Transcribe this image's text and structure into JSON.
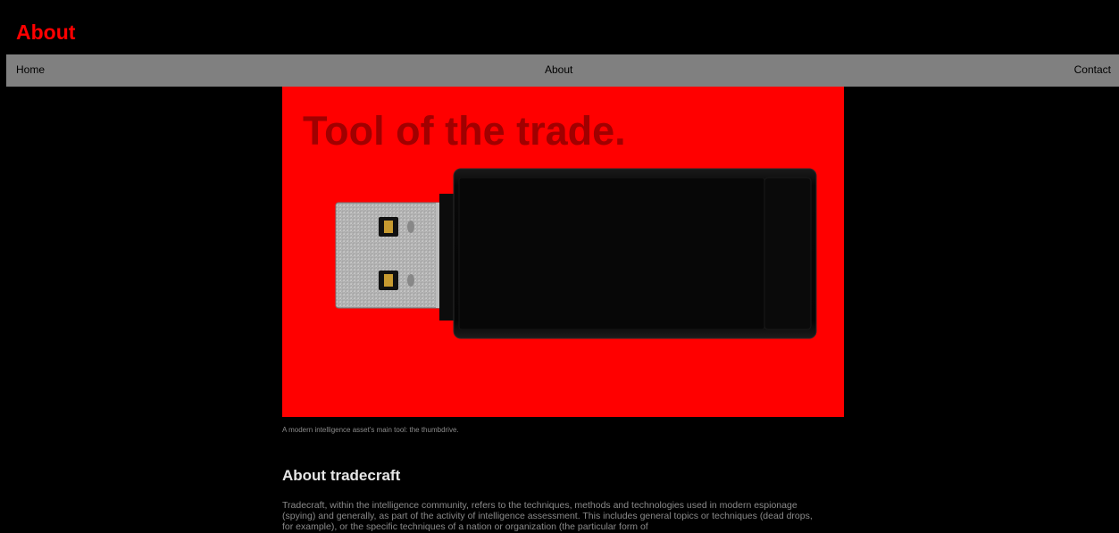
{
  "header": {
    "title": "About"
  },
  "nav": {
    "home": "Home",
    "about": "About",
    "contact": "Contact"
  },
  "hero": {
    "heading": "Tool of the trade.",
    "caption": "A modern intelligence asset's main tool: the thumbdrive."
  },
  "section": {
    "heading": "About tradecraft",
    "body": "Tradecraft, within the intelligence community, refers to the techniques, methods and technologies used in modern espionage (spying) and generally, as part of the activity of intelligence assessment. This includes general topics or techniques (dead drops, for example), or the specific techniques of a nation or organization (the particular form of"
  },
  "colors": {
    "background": "#000000",
    "title_red": "#ff0000",
    "hero_red": "#ff0000",
    "hero_heading": "#a00000",
    "nav_gray": "#808080",
    "muted_text": "#8a8a8a"
  },
  "icons": {
    "hero_image": "usb-thumbdrive"
  }
}
